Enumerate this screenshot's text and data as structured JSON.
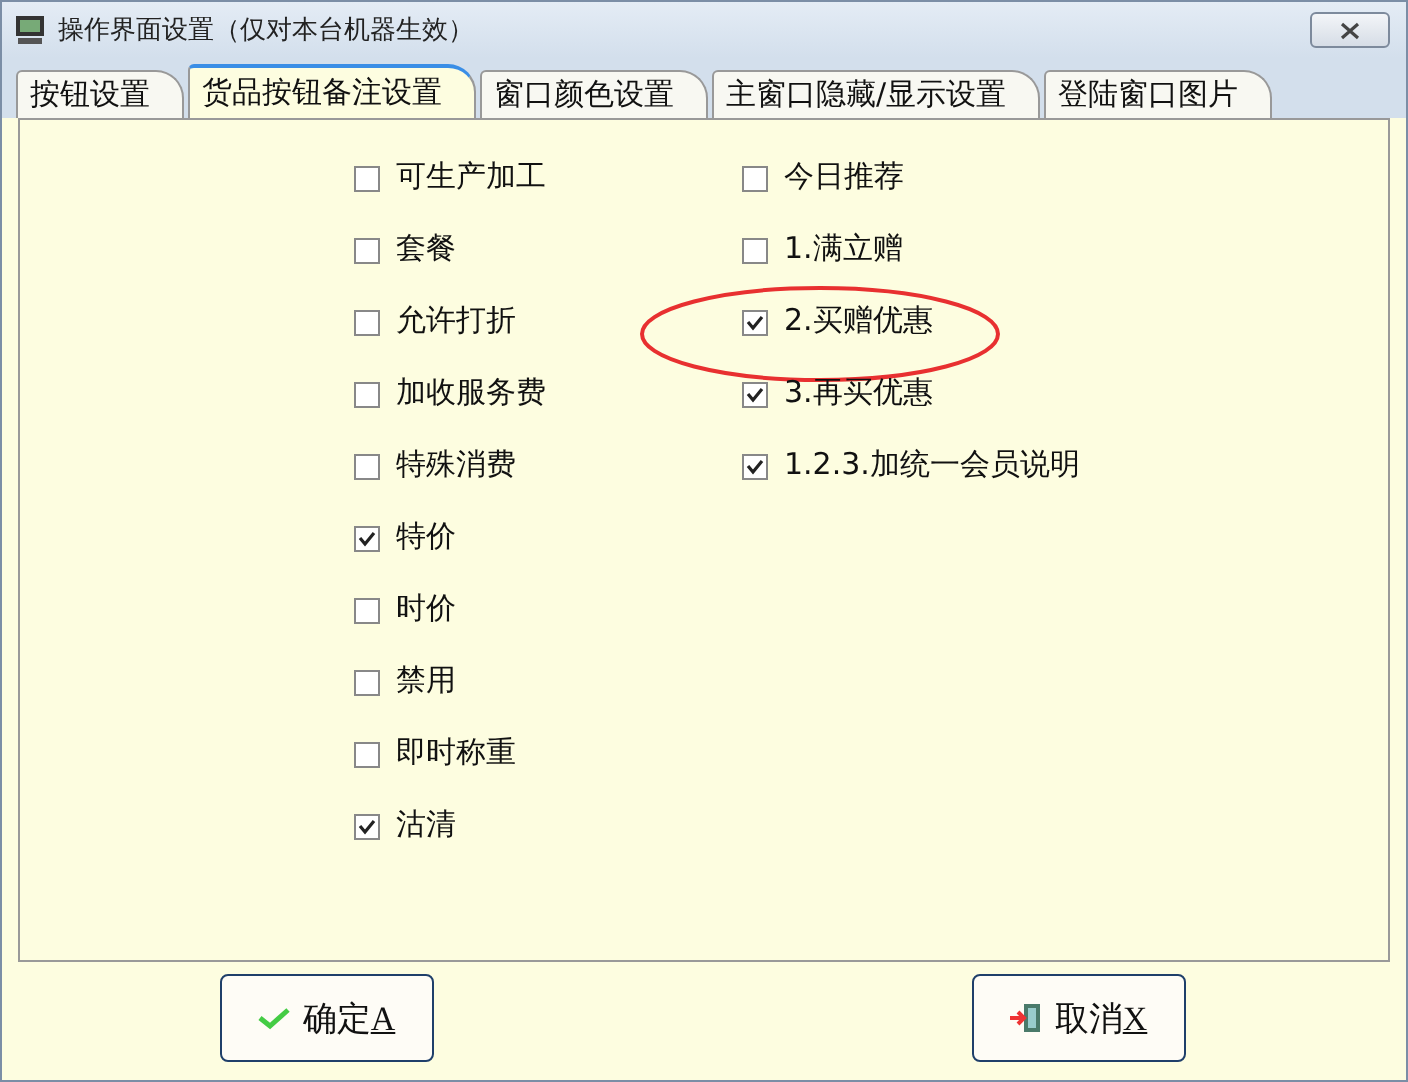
{
  "window": {
    "title": "操作界面设置（仅对本台机器生效）"
  },
  "tabs": [
    {
      "label": "按钮设置",
      "selected": false
    },
    {
      "label": "货品按钮备注设置",
      "selected": true
    },
    {
      "label": "窗口颜色设置",
      "selected": false
    },
    {
      "label": "主窗口隐藏/显示设置",
      "selected": false
    },
    {
      "label": "登陆窗口图片",
      "selected": false
    }
  ],
  "columns": [
    [
      {
        "label": "可生产加工",
        "checked": false
      },
      {
        "label": "套餐",
        "checked": false
      },
      {
        "label": "允许打折",
        "checked": false
      },
      {
        "label": "加收服务费",
        "checked": false
      },
      {
        "label": "特殊消费",
        "checked": false
      },
      {
        "label": "特价",
        "checked": true
      },
      {
        "label": "时价",
        "checked": false
      },
      {
        "label": "禁用",
        "checked": false
      },
      {
        "label": "即时称重",
        "checked": false
      },
      {
        "label": "沽清",
        "checked": true
      }
    ],
    [
      {
        "label": "今日推荐",
        "checked": false
      },
      {
        "label": "1.满立赠",
        "checked": false
      },
      {
        "label": "2.买赠优惠",
        "checked": true,
        "circled": true
      },
      {
        "label": "3.再买优惠",
        "checked": true
      },
      {
        "label": "1.2.3.加统一会员说明",
        "checked": true
      }
    ]
  ],
  "buttons": [
    {
      "kind": "ok",
      "label": "确定",
      "accesskey": "A"
    },
    {
      "kind": "cancel",
      "label": "取消",
      "accesskey": "X"
    }
  ]
}
